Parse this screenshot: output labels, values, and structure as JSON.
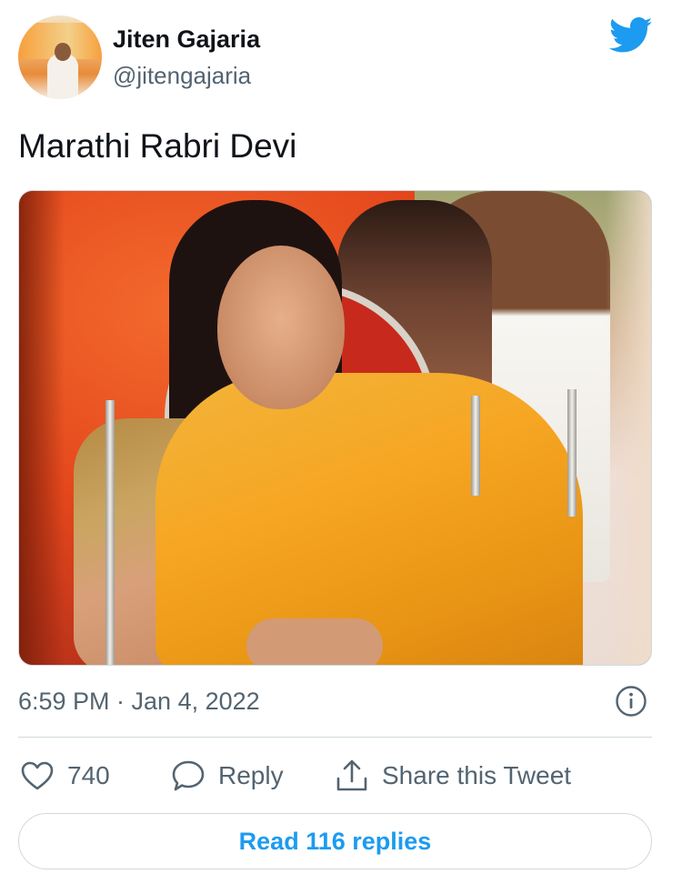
{
  "author": {
    "name": "Jiten Gajaria",
    "handle": "@jitengajaria",
    "avatar_icon": "profile-photo"
  },
  "brand_icon": "twitter-bird-icon",
  "tweet": {
    "text": "Marathi Rabri Devi",
    "media_icon": "photo",
    "timestamp": "6:59 PM · Jan 4, 2022"
  },
  "actions": {
    "like_count": "740",
    "reply_label": "Reply",
    "share_label": "Share this Tweet"
  },
  "read_replies_label": "Read 116 replies",
  "colors": {
    "accent": "#1d9bf0",
    "secondary_text": "#536471",
    "border": "#cfd9de"
  }
}
